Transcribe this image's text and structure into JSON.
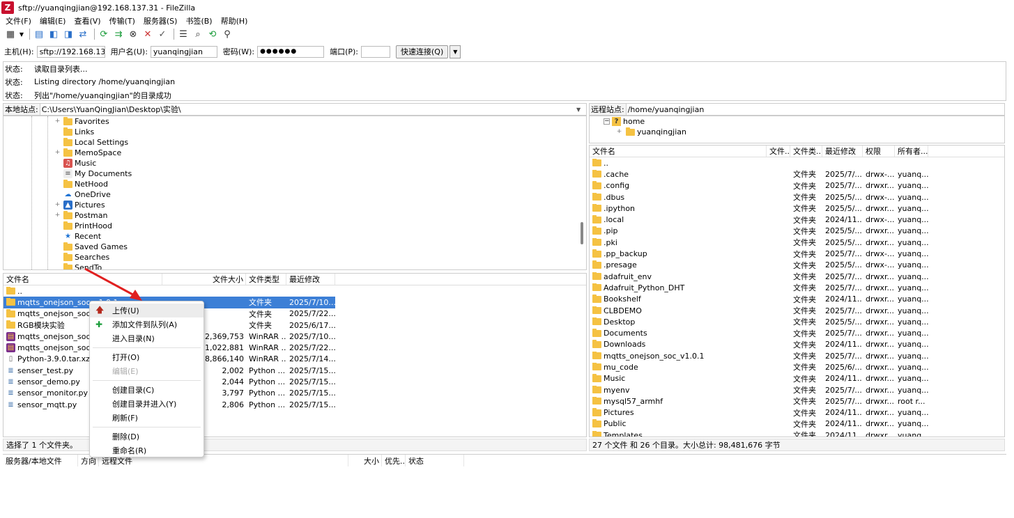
{
  "window": {
    "title": "sftp://yuanqingjian@192.168.137.31 - FileZilla",
    "app_icon": "Z"
  },
  "menu": [
    "文件(F)",
    "编辑(E)",
    "查看(V)",
    "传输(T)",
    "服务器(S)",
    "书签(B)",
    "帮助(H)"
  ],
  "quickconnect": {
    "host_label": "主机(H):",
    "host_value": "sftp://192.168.137.",
    "user_label": "用户名(U):",
    "user_value": "yuanqingjian",
    "pass_label": "密码(W):",
    "pass_value": "●●●●●●",
    "port_label": "端口(P):",
    "port_value": "",
    "connect_label": "快速连接(Q)"
  },
  "log": [
    {
      "k": "状态:",
      "v": "读取目录列表..."
    },
    {
      "k": "状态:",
      "v": "Listing directory /home/yuanqingjian"
    },
    {
      "k": "状态:",
      "v": "列出\"/home/yuanqingjian\"的目录成功"
    }
  ],
  "local": {
    "path_label": "本地站点:",
    "path": "C:\\Users\\YuanQingJian\\Desktop\\实验\\",
    "tree": [
      {
        "name": "Favorites",
        "icon": "folder",
        "exp": "+"
      },
      {
        "name": "Links",
        "icon": "folder",
        "exp": ""
      },
      {
        "name": "Local Settings",
        "icon": "folder",
        "exp": ""
      },
      {
        "name": "MemoSpace",
        "icon": "folder",
        "exp": "+"
      },
      {
        "name": "Music",
        "icon": "music",
        "exp": ""
      },
      {
        "name": "My Documents",
        "icon": "doc",
        "exp": ""
      },
      {
        "name": "NetHood",
        "icon": "folder",
        "exp": ""
      },
      {
        "name": "OneDrive",
        "icon": "cloud",
        "exp": ""
      },
      {
        "name": "Pictures",
        "icon": "pic",
        "exp": "+"
      },
      {
        "name": "Postman",
        "icon": "folder",
        "exp": "+"
      },
      {
        "name": "PrintHood",
        "icon": "folder",
        "exp": ""
      },
      {
        "name": "Recent",
        "icon": "recent",
        "exp": ""
      },
      {
        "name": "Saved Games",
        "icon": "folder",
        "exp": ""
      },
      {
        "name": "Searches",
        "icon": "folder",
        "exp": ""
      },
      {
        "name": "SendTo",
        "icon": "folder",
        "exp": ""
      }
    ],
    "headers": [
      "文件名",
      "文件大小",
      "文件类型",
      "最近修改"
    ],
    "files": [
      {
        "name": "..",
        "size": "",
        "type": "",
        "mod": "",
        "icon": "folder"
      },
      {
        "name": "mqtts_onejson_soc_v1.0.1",
        "size": "",
        "type": "文件夹",
        "mod": "2025/7/10...",
        "icon": "folder",
        "selected": true
      },
      {
        "name": "mqtts_onejson_soc_v...",
        "size": "",
        "type": "文件夹",
        "mod": "2025/7/22...",
        "icon": "folder"
      },
      {
        "name": "RGB模块实验",
        "size": "",
        "type": "文件夹",
        "mod": "2025/6/17...",
        "icon": "folder"
      },
      {
        "name": "mqtts_onejson_soc_v...",
        "size": "2,369,753",
        "type": "WinRAR ...",
        "mod": "2025/7/10...",
        "icon": "rar"
      },
      {
        "name": "mqtts_onejson_soc_v...",
        "size": "1,022,881",
        "type": "WinRAR ...",
        "mod": "2025/7/22...",
        "icon": "rar"
      },
      {
        "name": "Python-3.9.0.tar.xz",
        "size": "18,866,140",
        "type": "WinRAR ...",
        "mod": "2025/7/14...",
        "icon": "file"
      },
      {
        "name": "senser_test.py",
        "size": "2,002",
        "type": "Python ...",
        "mod": "2025/7/15...",
        "icon": "py"
      },
      {
        "name": "sensor_demo.py",
        "size": "2,044",
        "type": "Python ...",
        "mod": "2025/7/15...",
        "icon": "py"
      },
      {
        "name": "sensor_monitor.py",
        "size": "3,797",
        "type": "Python ...",
        "mod": "2025/7/15...",
        "icon": "py"
      },
      {
        "name": "sensor_mqtt.py",
        "size": "2,806",
        "type": "Python ...",
        "mod": "2025/7/15...",
        "icon": "py"
      }
    ],
    "status": "选择了 1 个文件夹。"
  },
  "remote": {
    "path_label": "远程站点:",
    "path": "/home/yuanqingjian",
    "tree": [
      {
        "name": "home",
        "icon": "unknown",
        "exp": "−"
      },
      {
        "name": "yuanqingjian",
        "icon": "folder",
        "exp": "+"
      }
    ],
    "headers": [
      "文件名",
      "文件...",
      "文件类...",
      "最近修改",
      "权限",
      "所有者..."
    ],
    "files": [
      {
        "name": "..",
        "type": "",
        "mod": "",
        "perm": "",
        "owner": ""
      },
      {
        "name": ".cache",
        "type": "文件夹",
        "mod": "2025/7/...",
        "perm": "drwx-...",
        "owner": "yuanq..."
      },
      {
        "name": ".config",
        "type": "文件夹",
        "mod": "2025/7/...",
        "perm": "drwxr...",
        "owner": "yuanq..."
      },
      {
        "name": ".dbus",
        "type": "文件夹",
        "mod": "2025/5/...",
        "perm": "drwx-...",
        "owner": "yuanq..."
      },
      {
        "name": ".ipython",
        "type": "文件夹",
        "mod": "2025/5/...",
        "perm": "drwxr...",
        "owner": "yuanq..."
      },
      {
        "name": ".local",
        "type": "文件夹",
        "mod": "2024/11...",
        "perm": "drwx-...",
        "owner": "yuanq..."
      },
      {
        "name": ".pip",
        "type": "文件夹",
        "mod": "2025/5/...",
        "perm": "drwxr...",
        "owner": "yuanq..."
      },
      {
        "name": ".pki",
        "type": "文件夹",
        "mod": "2025/5/...",
        "perm": "drwxr...",
        "owner": "yuanq..."
      },
      {
        "name": ".pp_backup",
        "type": "文件夹",
        "mod": "2025/7/...",
        "perm": "drwx-...",
        "owner": "yuanq..."
      },
      {
        "name": ".presage",
        "type": "文件夹",
        "mod": "2025/5/...",
        "perm": "drwx-...",
        "owner": "yuanq..."
      },
      {
        "name": "adafruit_env",
        "type": "文件夹",
        "mod": "2025/7/...",
        "perm": "drwxr...",
        "owner": "yuanq..."
      },
      {
        "name": "Adafruit_Python_DHT",
        "type": "文件夹",
        "mod": "2025/7/...",
        "perm": "drwxr...",
        "owner": "yuanq..."
      },
      {
        "name": "Bookshelf",
        "type": "文件夹",
        "mod": "2024/11...",
        "perm": "drwxr...",
        "owner": "yuanq..."
      },
      {
        "name": "CLBDEMO",
        "type": "文件夹",
        "mod": "2025/7/...",
        "perm": "drwxr...",
        "owner": "yuanq..."
      },
      {
        "name": "Desktop",
        "type": "文件夹",
        "mod": "2025/5/...",
        "perm": "drwxr...",
        "owner": "yuanq..."
      },
      {
        "name": "Documents",
        "type": "文件夹",
        "mod": "2025/7/...",
        "perm": "drwxr...",
        "owner": "yuanq..."
      },
      {
        "name": "Downloads",
        "type": "文件夹",
        "mod": "2024/11...",
        "perm": "drwxr...",
        "owner": "yuanq..."
      },
      {
        "name": "mqtts_onejson_soc_v1.0.1",
        "type": "文件夹",
        "mod": "2025/7/...",
        "perm": "drwxr...",
        "owner": "yuanq..."
      },
      {
        "name": "mu_code",
        "type": "文件夹",
        "mod": "2025/6/...",
        "perm": "drwxr...",
        "owner": "yuanq..."
      },
      {
        "name": "Music",
        "type": "文件夹",
        "mod": "2024/11...",
        "perm": "drwxr...",
        "owner": "yuanq..."
      },
      {
        "name": "myenv",
        "type": "文件夹",
        "mod": "2025/7/...",
        "perm": "drwxr...",
        "owner": "yuanq..."
      },
      {
        "name": "mysql57_armhf",
        "type": "文件夹",
        "mod": "2025/7/...",
        "perm": "drwxr...",
        "owner": "root r..."
      },
      {
        "name": "Pictures",
        "type": "文件夹",
        "mod": "2024/11...",
        "perm": "drwxr...",
        "owner": "yuanq..."
      },
      {
        "name": "Public",
        "type": "文件夹",
        "mod": "2024/11...",
        "perm": "drwxr...",
        "owner": "yuanq..."
      },
      {
        "name": "Templates",
        "type": "文件夹",
        "mod": "2024/11...",
        "perm": "drwxr...",
        "owner": "yuanq..."
      }
    ],
    "status": "27 个文件 和 26 个目录。大小总计: 98,481,676 字节"
  },
  "context_menu": [
    {
      "label": "上传(U)",
      "icon": "upload",
      "hover": true
    },
    {
      "label": "添加文件到队列(A)",
      "icon": "add"
    },
    {
      "label": "进入目录(N)"
    },
    {
      "sep": true
    },
    {
      "label": "打开(O)"
    },
    {
      "label": "编辑(E)",
      "disabled": true
    },
    {
      "sep": true
    },
    {
      "label": "创建目录(C)"
    },
    {
      "label": "创建目录并进入(Y)"
    },
    {
      "label": "刷新(F)"
    },
    {
      "sep": true
    },
    {
      "label": "删除(D)"
    },
    {
      "label": "重命名(R)"
    }
  ],
  "queue": {
    "headers": [
      "服务器/本地文件",
      "方向",
      "远程文件",
      "大小",
      "优先...",
      "状态"
    ]
  },
  "colors": {
    "selection": "#3c7fd6",
    "folder": "#f5c243",
    "arrow": "#e02020"
  }
}
